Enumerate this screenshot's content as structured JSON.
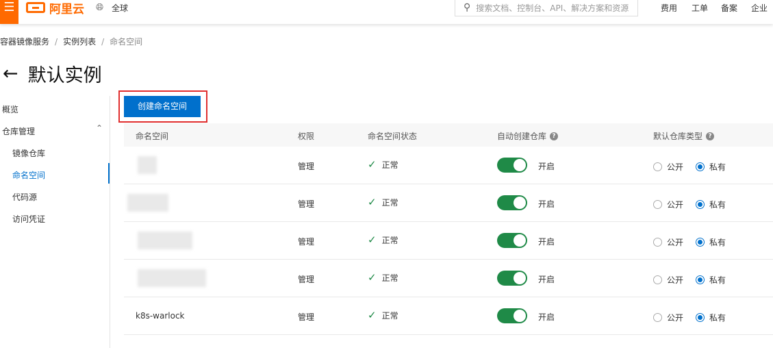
{
  "topbar": {
    "brand": "阿里云",
    "region": "全球",
    "search_placeholder": "搜索文档、控制台、API、解决方案和资源",
    "nav": [
      "费用",
      "工单",
      "备案",
      "企业"
    ]
  },
  "breadcrumb": [
    "容器镜像服务",
    "实例列表",
    "命名空间"
  ],
  "page_title": "默认实例",
  "sidebar": {
    "overview": "概览",
    "repo_group": "仓库管理",
    "items": [
      "镜像仓库",
      "命名空间",
      "代码源",
      "访问凭证"
    ],
    "active": "命名空间"
  },
  "create_button": "创建命名空间",
  "table": {
    "headers": [
      "命名空间",
      "权限",
      "命名空间状态",
      "自动创建仓库",
      "默认仓库类型"
    ],
    "rows": [
      {
        "name": "",
        "permission": "管理",
        "status": "正常",
        "auto_create": "开启",
        "auto_create_on": true,
        "type_options": [
          "公开",
          "私有"
        ],
        "selected": "私有"
      },
      {
        "name": "",
        "permission": "管理",
        "status": "正常",
        "auto_create": "开启",
        "auto_create_on": true,
        "type_options": [
          "公开",
          "私有"
        ],
        "selected": "私有"
      },
      {
        "name": "",
        "permission": "管理",
        "status": "正常",
        "auto_create": "开启",
        "auto_create_on": true,
        "type_options": [
          "公开",
          "私有"
        ],
        "selected": "私有"
      },
      {
        "name": "",
        "permission": "管理",
        "status": "正常",
        "auto_create": "开启",
        "auto_create_on": true,
        "type_options": [
          "公开",
          "私有"
        ],
        "selected": "私有"
      },
      {
        "name": "k8s-warlock",
        "permission": "管理",
        "status": "正常",
        "auto_create": "开启",
        "auto_create_on": true,
        "type_options": [
          "公开",
          "私有"
        ],
        "selected": "私有"
      }
    ]
  },
  "colors": {
    "brand": "#ff6a00",
    "primary": "#0070cc",
    "success": "#1f8a47",
    "highlight": "#e02e2e"
  }
}
